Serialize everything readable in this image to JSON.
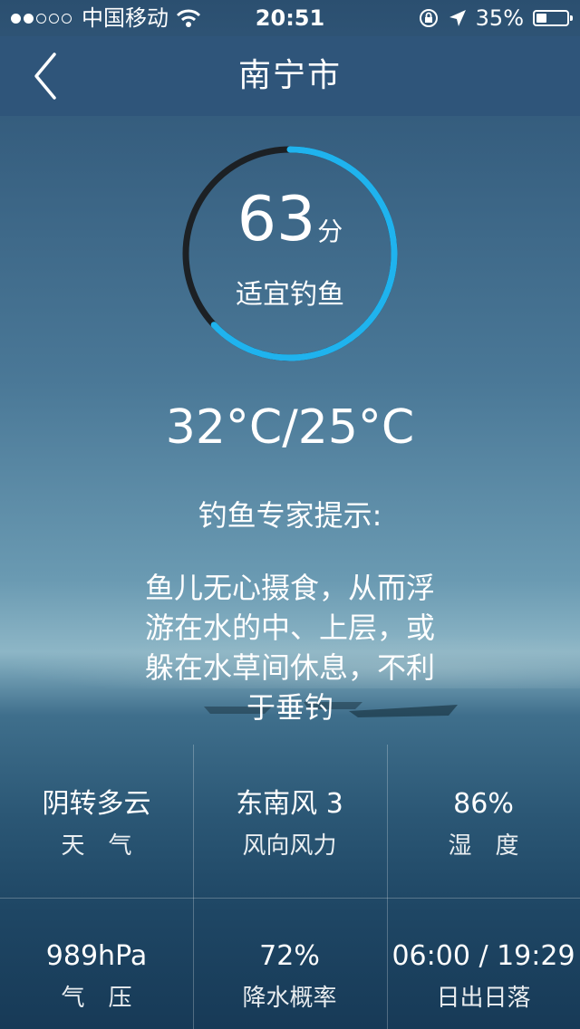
{
  "status_bar": {
    "signal_dots": [
      true,
      true,
      false,
      false,
      false
    ],
    "carrier": "中国移动",
    "time": "20:51",
    "battery_percent": "35%",
    "battery_level": 0.35
  },
  "nav": {
    "back_icon": "chevron-left-icon",
    "title": "南宁市"
  },
  "score": {
    "value": "63",
    "unit": "分",
    "label": "适宜钓鱼",
    "fraction": 0.63,
    "arc_color": "#1fb3ee",
    "track_color": "#1c2024"
  },
  "temperature": "32°C/25°C",
  "tip": {
    "title": "钓鱼专家提示:",
    "body": "鱼儿无心摄食，从而浮游在水的中、上层，或躲在水草间休息，不利于垂钓"
  },
  "grid": [
    {
      "value": "阴转多云",
      "label": "天　气"
    },
    {
      "value": "东南风 3",
      "label": "风向风力"
    },
    {
      "value": "86%",
      "label": "湿　度"
    },
    {
      "value": "989hPa",
      "label": "气　压"
    },
    {
      "value": "72%",
      "label": "降水概率"
    },
    {
      "value": "06:00 / 19:29",
      "label": "日出日落"
    }
  ]
}
